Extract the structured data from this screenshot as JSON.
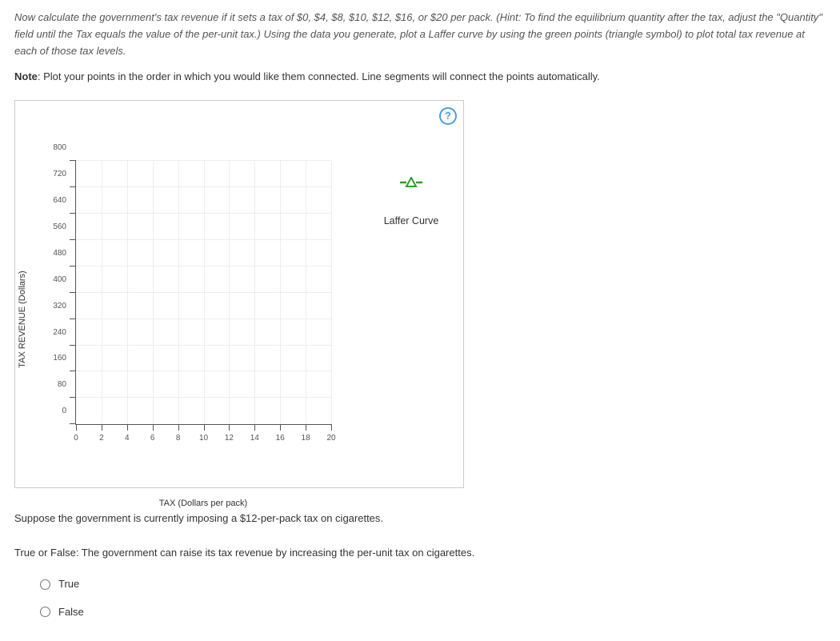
{
  "instructions_html": "Now calculate the government's tax revenue if it sets a tax of $0, $4, $8, $10, $12, $16, or $20 per pack. (Hint: To find the equilibrium quantity after the tax, adjust the \"Quantity\" field until the Tax equals the value of the per-unit tax.) Using the data you generate, plot a Laffer curve by using the green points (triangle symbol) to plot total tax revenue at each of those tax levels.",
  "note_label": "Note",
  "note_text": ": Plot your points in the order in which you would like them connected. Line segments will connect the points automatically.",
  "help_label": "?",
  "legend": {
    "name": "Laffer Curve"
  },
  "question": {
    "scenario": "Suppose the government is currently imposing a $12-per-pack tax on cigarettes.",
    "statement": "True or False: The government can raise its tax revenue by increasing the per-unit tax on cigarettes.",
    "options": {
      "true": "True",
      "false": "False"
    }
  },
  "chart_data": {
    "type": "scatter",
    "title": "",
    "xlabel": "TAX (Dollars per pack)",
    "ylabel": "TAX REVENUE (Dollars)",
    "xlim": [
      0,
      20
    ],
    "ylim": [
      0,
      800
    ],
    "x_ticks": [
      0,
      2,
      4,
      6,
      8,
      10,
      12,
      14,
      16,
      18,
      20
    ],
    "y_ticks": [
      0,
      80,
      160,
      240,
      320,
      400,
      480,
      560,
      640,
      720,
      800
    ],
    "series": [
      {
        "name": "Laffer Curve",
        "color": "#2e9e2e",
        "symbol": "triangle",
        "x": [],
        "y": []
      }
    ],
    "grid": true
  }
}
